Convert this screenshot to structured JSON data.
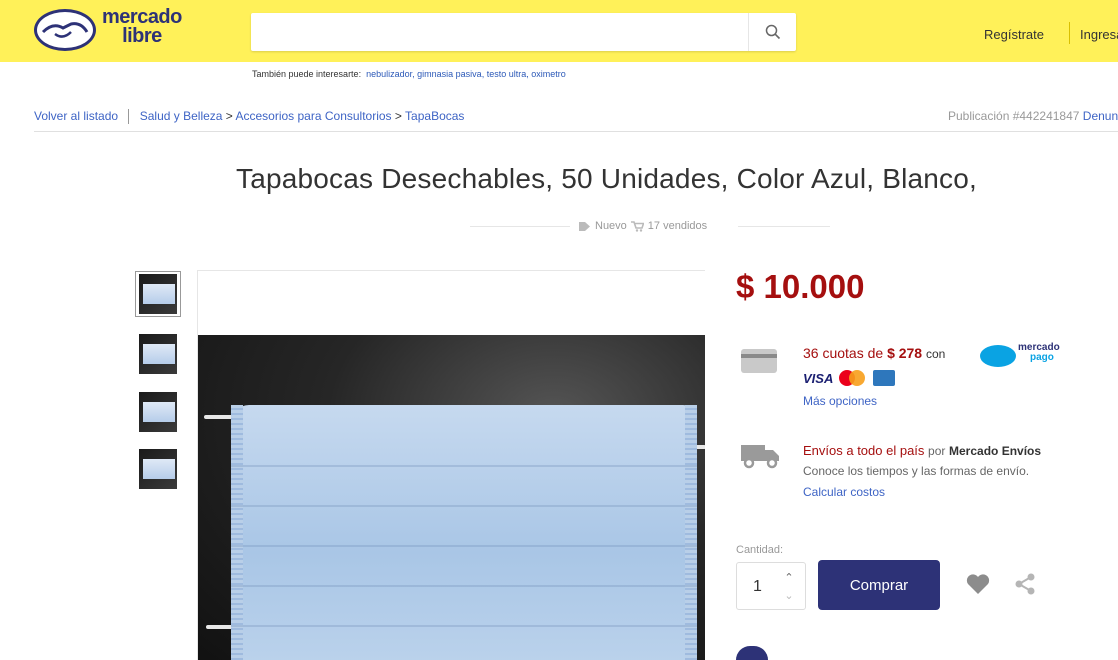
{
  "header": {
    "logo_text_line1": "mercado",
    "logo_text_line2": "libre",
    "search_placeholder": "",
    "register": "Regístrate",
    "login": "Ingresa"
  },
  "suggestions": {
    "prefix": "También puede interesarte:",
    "items": [
      "nebulizador,",
      "gimnasia pasiva,",
      "testo ultra,",
      "oximetro"
    ]
  },
  "breadcrumb": {
    "back": "Volver al listado",
    "path": [
      "Salud y Belleza",
      "Accesorios para Consultorios",
      "TapaBocas"
    ],
    "separator": ">",
    "publication": "Publicación #442241847",
    "denounce": "Denunciar"
  },
  "product": {
    "title": "Tapabocas Desechables, 50 Unidades, Color Azul, Blanco,",
    "condition": "Nuevo",
    "sold": "17 vendidos",
    "price": "$ 10.000"
  },
  "payment": {
    "cuotas_prefix": "36 cuotas de",
    "cuotas_amount": "$ 278",
    "cuotas_con": "con",
    "mp_line1": "mercado",
    "mp_line2": "pago",
    "visa": "VISA",
    "more_options": "Más opciones"
  },
  "shipping": {
    "title": "Envíos a todo el país",
    "por": "por",
    "carrier": "Mercado Envíos",
    "subtitle": "Conoce los tiempos y las formas de envío.",
    "calculate": "Calcular costos"
  },
  "purchase": {
    "quantity_label": "Cantidad:",
    "quantity": "1",
    "buy_label": "Comprar"
  },
  "colors": {
    "brand_yellow": "#fff159",
    "brand_blue": "#2d3277",
    "price_red": "#a50f0f",
    "link_blue": "#3e64c5"
  }
}
